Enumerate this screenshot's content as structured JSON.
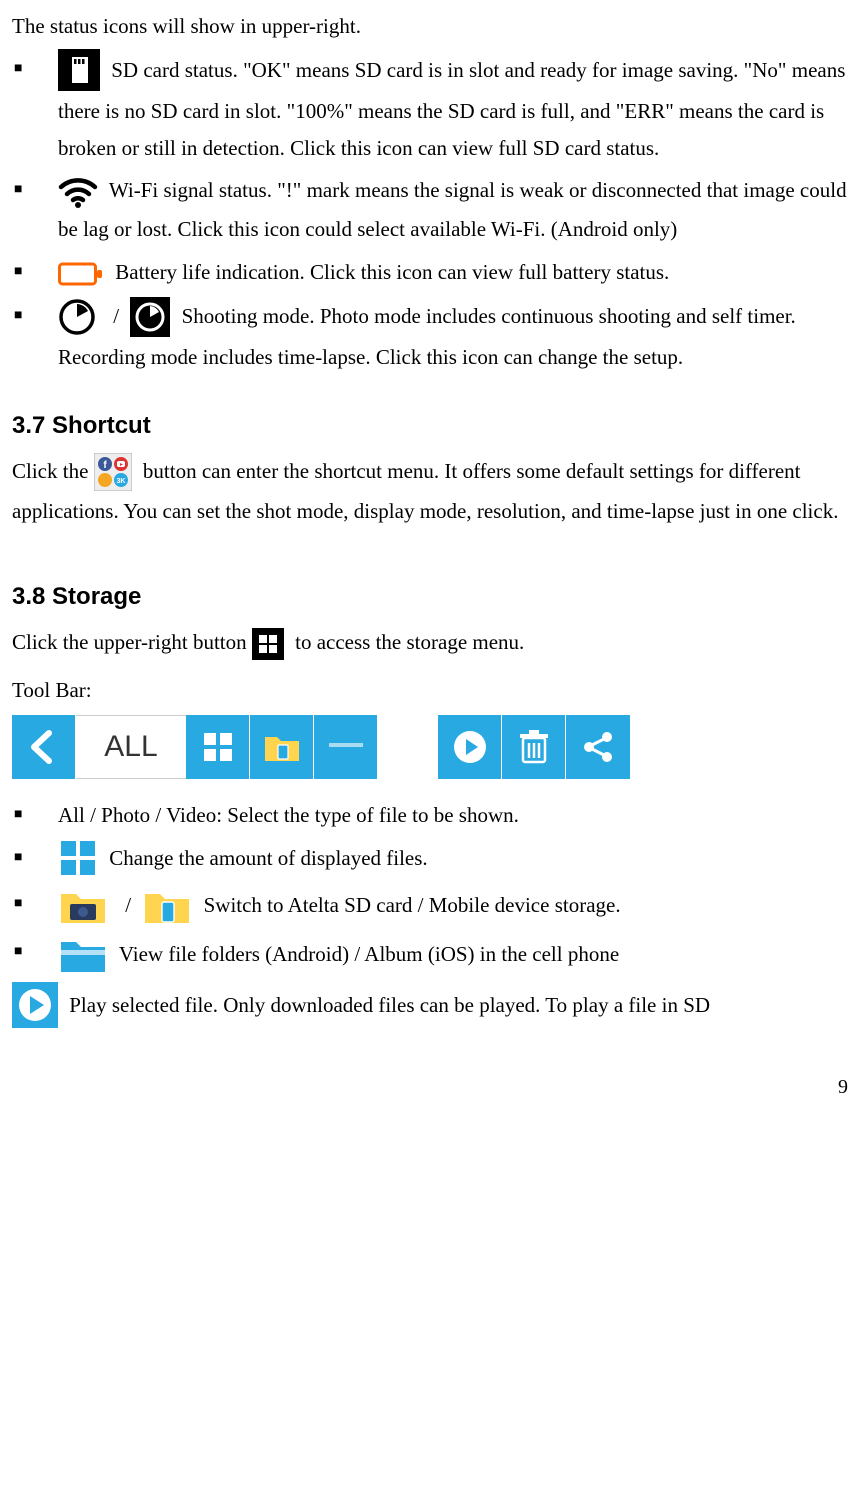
{
  "intro": "The status icons will show in upper-right.",
  "status": [
    {
      "text": "SD card status. \"OK\" means SD card is in slot and ready for image saving. \"No\" means there is no SD card in slot. \"100%\" means the SD card is full, and \"ERR\" means the card is broken or still in detection. Click this icon can view full SD card status."
    },
    {
      "text": "Wi-Fi signal status. \"!\" mark means the signal is weak or disconnected that image could be lag or lost. Click this icon could select available Wi-Fi. (Android only)"
    },
    {
      "text": "Battery life indication. Click this icon can view full battery status."
    },
    {
      "text": "Shooting mode. Photo mode includes continuous shooting and self timer. Recording mode includes time-lapse. Click this icon can change the setup."
    }
  ],
  "sec37": {
    "heading": "3.7 Shortcut",
    "p1a": "Click the ",
    "p1b": " button can enter the shortcut menu. It offers some default settings for different applications. You can set the shot mode, display mode, resolution, and time-lapse just in one click."
  },
  "sec38": {
    "heading": "3.8 Storage",
    "p1a": "Click the upper-right button ",
    "p1b": " to access the storage menu.",
    "toolbar_label": "Tool Bar:",
    "all_label": "ALL",
    "items": [
      {
        "text": "All / Photo / Video: Select the type of file to be shown."
      },
      {
        "text": "Change the amount of displayed files."
      },
      {
        "text": "Switch to Atelta SD card / Mobile device storage."
      },
      {
        "text": "View file folders (Android) / Album (iOS) in the cell phone"
      },
      {
        "text": "Play selected file. Only downloaded files can be played. To play a file in SD"
      }
    ]
  },
  "page_number": "9"
}
